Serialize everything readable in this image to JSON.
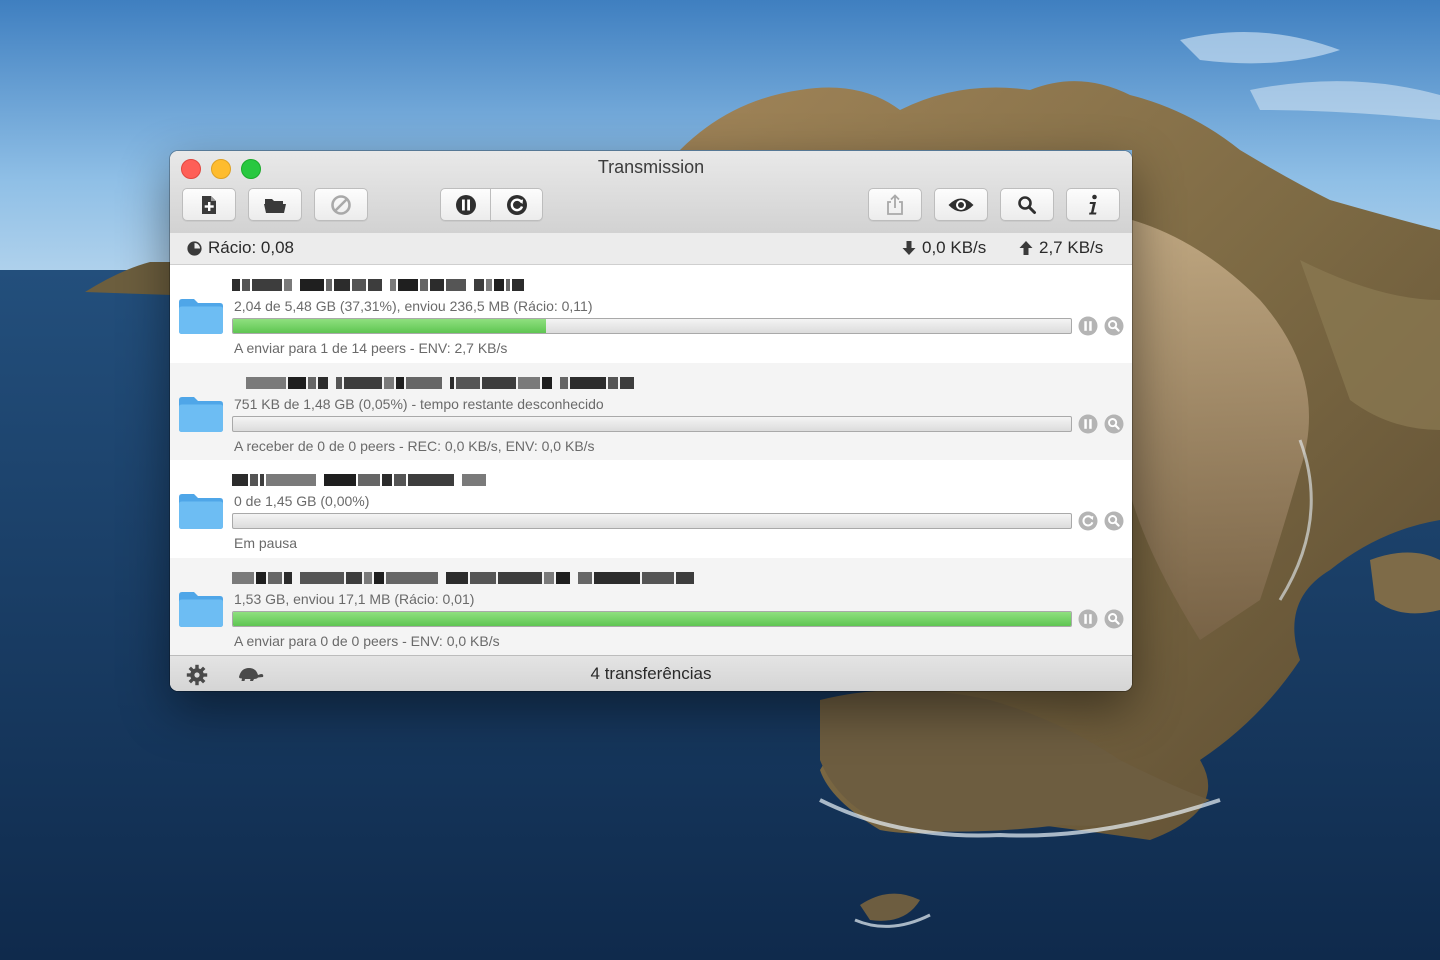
{
  "window": {
    "title": "Transmission"
  },
  "toolbar": {
    "buttons": [
      {
        "name": "create-torrent",
        "icon": "document-plus-icon"
      },
      {
        "name": "open-torrent",
        "icon": "folder-open-icon"
      },
      {
        "name": "remove-torrent",
        "icon": "prohibit-icon"
      },
      {
        "name": "pause-all",
        "icon": "pause-icon"
      },
      {
        "name": "resume-all",
        "icon": "resume-icon"
      },
      {
        "name": "share",
        "icon": "share-icon"
      },
      {
        "name": "quick-look",
        "icon": "eye-icon"
      },
      {
        "name": "filter",
        "icon": "magnifier-icon"
      },
      {
        "name": "inspector",
        "icon": "info-icon"
      }
    ]
  },
  "stats": {
    "ratio": "Rácio: 0,08",
    "download_speed": "0,0 KB/s",
    "upload_speed": "2,7 KB/s"
  },
  "torrents": [
    {
      "progress_text": "2,04 de 5,48 GB (37,31%), enviou 236,5 MB (Rácio: 0,11)",
      "progress": 0.3731,
      "status": "A enviar para 1 de 14 peers - ENV: 2,7 KB/s",
      "state": "active"
    },
    {
      "progress_text": "751 KB de 1,48 GB (0,05%) - tempo restante desconhecido",
      "progress": 0.0005,
      "status": "A receber de 0 de 0 peers - REC: 0,0 KB/s, ENV: 0,0 KB/s",
      "state": "active"
    },
    {
      "progress_text": "0 de 1,45 GB (0,00%)",
      "progress": 0.0,
      "status": "Em pausa",
      "state": "paused"
    },
    {
      "progress_text": "1,53 GB, enviou 17,1 MB (Rácio: 0,01)",
      "progress": 1.0,
      "status": "A enviar para 0 de 0 peers - ENV: 0,0 KB/s",
      "state": "active"
    }
  ],
  "footer": {
    "count": "4 transferências"
  },
  "colors": {
    "progress_green": "#5fc552",
    "close": "#fe5f57",
    "minimize": "#febc2e",
    "maximize": "#28c840"
  }
}
